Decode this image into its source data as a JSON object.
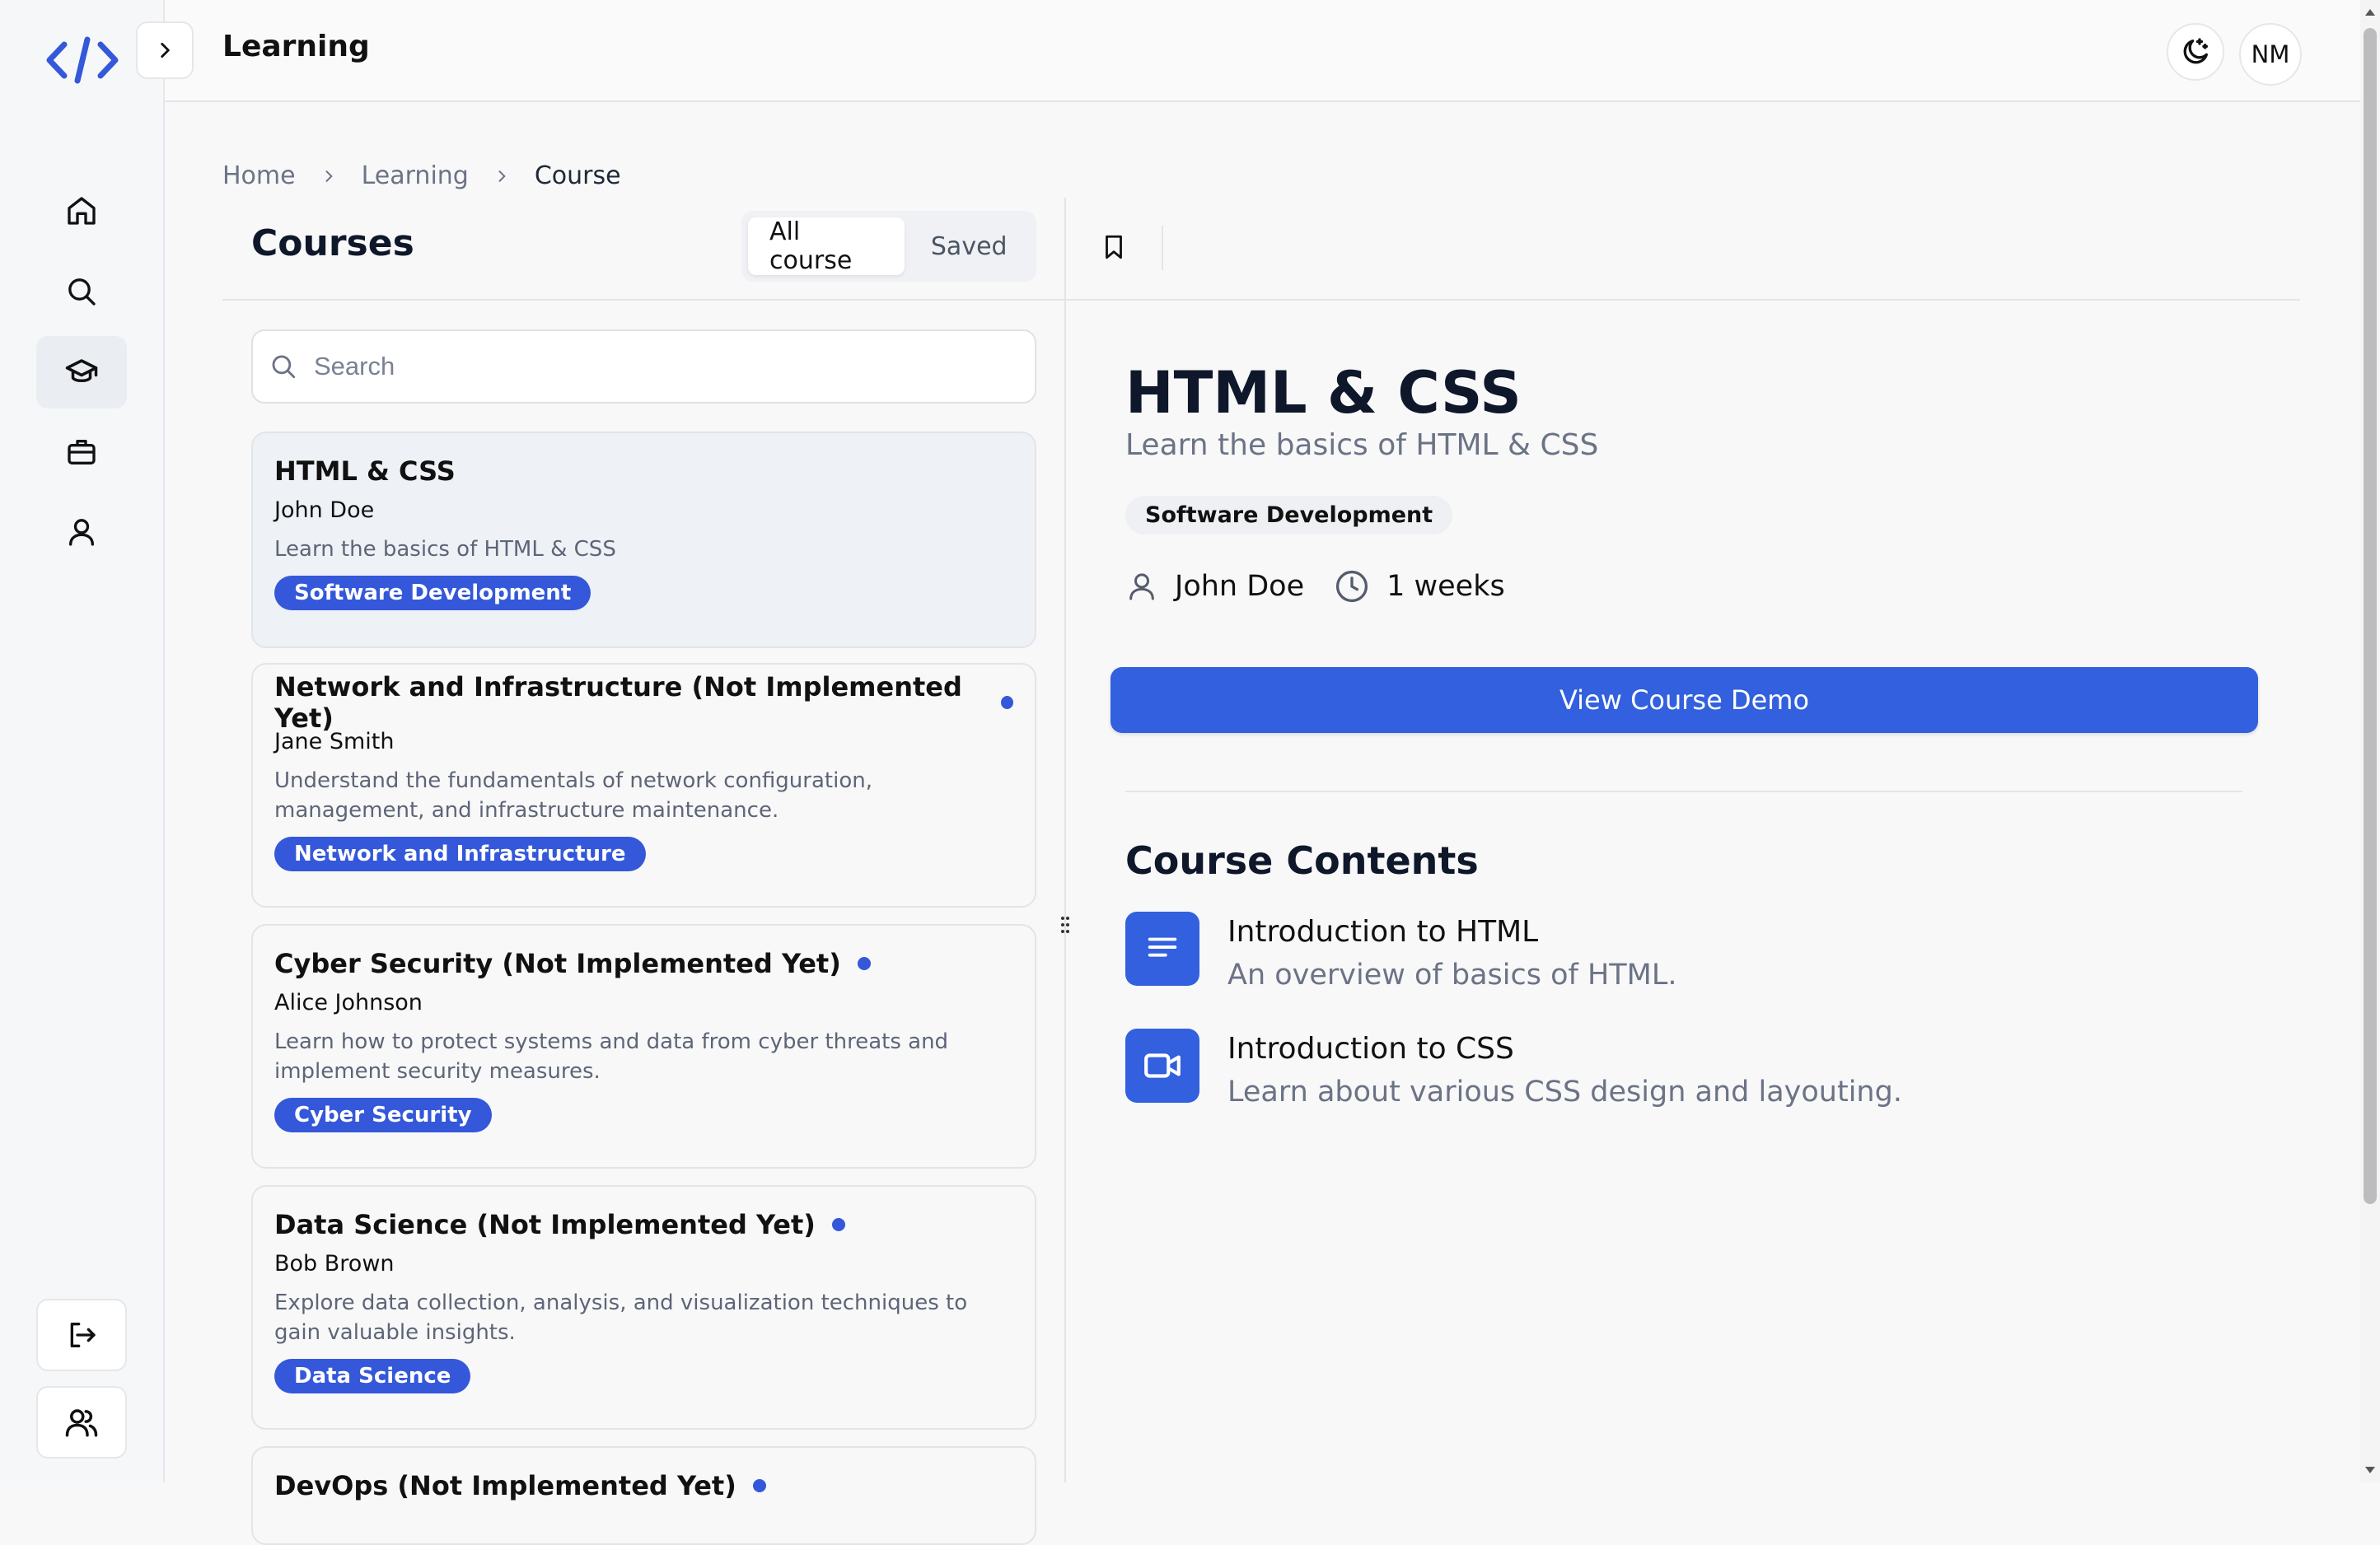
{
  "header": {
    "title": "Learning",
    "avatar_initials": "NM"
  },
  "breadcrumb": {
    "home": "Home",
    "learning": "Learning",
    "current": "Course"
  },
  "courses": {
    "title": "Courses",
    "tabs": {
      "all": "All course",
      "saved": "Saved"
    },
    "search_placeholder": "Search",
    "items": [
      {
        "title": "HTML & CSS",
        "author": "John Doe",
        "description": "Learn the basics of HTML & CSS",
        "tag": "Software Development",
        "new": false
      },
      {
        "title": "Network and Infrastructure (Not Implemented Yet)",
        "author": "Jane Smith",
        "description": "Understand the fundamentals of network configuration, management, and infrastructure maintenance.",
        "tag": "Network and Infrastructure",
        "new": true
      },
      {
        "title": "Cyber Security (Not Implemented Yet)",
        "author": "Alice Johnson",
        "description": "Learn how to protect systems and data from cyber threats and implement security measures.",
        "tag": "Cyber Security",
        "new": true
      },
      {
        "title": "Data Science (Not Implemented Yet)",
        "author": "Bob Brown",
        "description": "Explore data collection, analysis, and visualization techniques to gain valuable insights.",
        "tag": "Data Science",
        "new": true
      },
      {
        "title": "DevOps (Not Implemented Yet)",
        "new": true
      }
    ]
  },
  "detail": {
    "title": "HTML & CSS",
    "subtitle": "Learn the basics of HTML & CSS",
    "tag": "Software Development",
    "author": "John Doe",
    "duration": "1 weeks",
    "demo_button": "View Course Demo",
    "contents_title": "Course Contents",
    "contents": [
      {
        "name": "Introduction to HTML",
        "description": "An overview of basics of HTML.",
        "icon": "text-lines-icon"
      },
      {
        "name": "Introduction to CSS",
        "description": "Learn about various CSS design and layouting.",
        "icon": "video-camera-icon"
      }
    ]
  },
  "colors": {
    "accent": "#3458d9",
    "button": "#3260de",
    "background": "#f8f8f9"
  }
}
